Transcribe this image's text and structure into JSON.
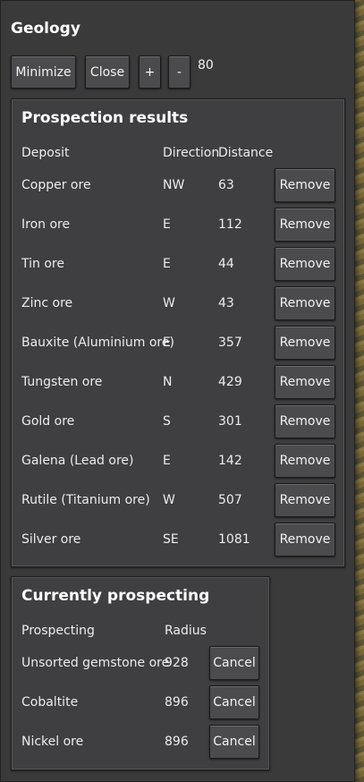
{
  "window": {
    "title": "Geology",
    "buttons": {
      "minimize": "Minimize",
      "close": "Close",
      "plus": "+",
      "minus": "-"
    },
    "zoom_value": "80"
  },
  "results": {
    "title": "Prospection results",
    "headers": {
      "deposit": "Deposit",
      "direction": "Direction",
      "distance": "Distance"
    },
    "remove_label": "Remove",
    "rows": [
      {
        "deposit": "Copper ore",
        "direction": "NW",
        "distance": "63"
      },
      {
        "deposit": "Iron ore",
        "direction": "E",
        "distance": "112"
      },
      {
        "deposit": "Tin ore",
        "direction": "E",
        "distance": "44"
      },
      {
        "deposit": "Zinc ore",
        "direction": "W",
        "distance": "43"
      },
      {
        "deposit": "Bauxite (Aluminium ore)",
        "direction": "E",
        "distance": "357"
      },
      {
        "deposit": "Tungsten ore",
        "direction": "N",
        "distance": "429"
      },
      {
        "deposit": "Gold ore",
        "direction": "S",
        "distance": "301"
      },
      {
        "deposit": "Galena (Lead ore)",
        "direction": "E",
        "distance": "142"
      },
      {
        "deposit": "Rutile (Titanium ore)",
        "direction": "W",
        "distance": "507"
      },
      {
        "deposit": "Silver ore",
        "direction": "SE",
        "distance": "1081"
      }
    ]
  },
  "prospecting": {
    "title": "Currently prospecting",
    "headers": {
      "prospecting": "Prospecting",
      "radius": "Radius"
    },
    "cancel_label": "Cancel",
    "rows": [
      {
        "name": "Unsorted gemstone ore",
        "radius": "928"
      },
      {
        "name": "Cobaltite",
        "radius": "896"
      },
      {
        "name": "Nickel ore",
        "radius": "896"
      }
    ]
  }
}
